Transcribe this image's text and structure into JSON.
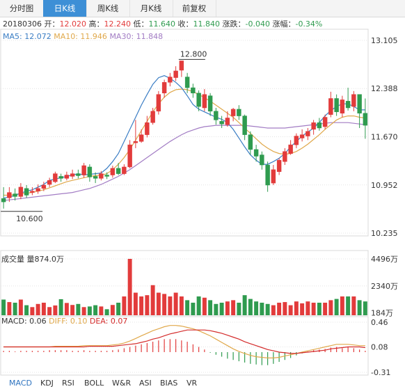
{
  "tabs": [
    {
      "label": "分时图",
      "active": false
    },
    {
      "label": "日K线",
      "active": true
    },
    {
      "label": "周K线",
      "active": false
    },
    {
      "label": "月K线",
      "active": false
    },
    {
      "label": "前复权",
      "active": false
    }
  ],
  "quote": {
    "date": "20180306",
    "open_label": "开：",
    "open": "12.020",
    "high_label": "高：",
    "high": "12.240",
    "low_label": "低：",
    "low": "11.640",
    "close_label": "收：",
    "close": "11.840",
    "change_label": "涨跌：",
    "change": "-0.040",
    "pct_label": "涨幅：",
    "pct": "-0.34%"
  },
  "ma_legend": {
    "ma5": "MA5: 12.072",
    "ma10": "MA10: 11.946",
    "ma30": "MA30: 11.848"
  },
  "volume_title": "成交量 量874.0万",
  "macd_legend": {
    "macd": "MACD: 0.06",
    "diff": "DIFF: 0.10",
    "dea": "DEA: 0.07"
  },
  "indicator_tabs": [
    "MACD",
    "KDJ",
    "RSI",
    "BOLL",
    "W&R",
    "ASI",
    "BIAS",
    "VR"
  ],
  "active_indicator": "MACD",
  "colors": {
    "up": "#e23b3b",
    "down": "#2f9b4f",
    "ma5": "#3a7dc4",
    "ma10": "#e0a84a",
    "ma30": "#a27cc4",
    "diff": "#e0a84a",
    "dea": "#d42b2b",
    "tab_active": "#3d8fd6"
  },
  "chart_data": {
    "type": "candlestick",
    "price_axis": {
      "ticks": [
        "13.105",
        "12.388",
        "11.670",
        "10.952",
        "10.235"
      ],
      "ylim": [
        10.235,
        13.105
      ]
    },
    "volume_axis": {
      "ticks": [
        "4496万",
        "2340万",
        "184万"
      ],
      "ylim": [
        0,
        4496
      ]
    },
    "macd_axis": {
      "ticks": [
        "0.46",
        "0.08",
        "-0.31"
      ],
      "ylim": [
        -0.31,
        0.46
      ]
    },
    "annotations": {
      "max": "12.800",
      "min": "10.600"
    },
    "candles": [
      [
        10.75,
        10.7,
        10.92,
        10.6
      ],
      [
        10.76,
        10.84,
        10.92,
        10.7
      ],
      [
        10.82,
        10.78,
        10.9,
        10.72
      ],
      [
        10.78,
        10.92,
        10.98,
        10.74
      ],
      [
        10.9,
        10.8,
        10.95,
        10.76
      ],
      [
        10.84,
        10.86,
        10.92,
        10.8
      ],
      [
        10.86,
        10.9,
        10.96,
        10.82
      ],
      [
        10.9,
        10.95,
        11.0,
        10.86
      ],
      [
        10.96,
        11.02,
        11.06,
        10.92
      ],
      [
        11.0,
        11.12,
        11.15,
        10.98
      ],
      [
        11.08,
        11.05,
        11.12,
        11.0
      ],
      [
        11.05,
        11.1,
        11.15,
        11.02
      ],
      [
        11.08,
        11.12,
        11.18,
        11.04
      ],
      [
        11.12,
        11.09,
        11.18,
        11.05
      ],
      [
        11.1,
        11.24,
        11.28,
        11.06
      ],
      [
        11.22,
        11.07,
        11.26,
        11.0
      ],
      [
        11.08,
        11.05,
        11.14,
        10.98
      ],
      [
        11.05,
        11.12,
        11.16,
        11.02
      ],
      [
        11.1,
        11.08,
        11.14,
        11.04
      ],
      [
        11.1,
        11.2,
        11.24,
        11.06
      ],
      [
        11.2,
        11.12,
        11.28,
        11.1
      ],
      [
        11.12,
        11.22,
        11.26,
        11.1
      ],
      [
        11.22,
        11.55,
        11.62,
        11.2
      ],
      [
        11.58,
        11.6,
        11.92,
        11.5
      ],
      [
        11.6,
        11.7,
        11.78,
        11.58
      ],
      [
        11.7,
        11.88,
        11.98,
        11.66
      ],
      [
        11.88,
        12.05,
        12.1,
        11.85
      ],
      [
        12.05,
        12.3,
        12.35,
        12.0
      ],
      [
        12.32,
        12.48,
        12.52,
        12.25
      ],
      [
        12.48,
        12.56,
        12.62,
        12.42
      ],
      [
        12.55,
        12.65,
        12.72,
        12.5
      ],
      [
        12.66,
        12.8,
        12.8,
        12.56
      ],
      [
        12.56,
        12.4,
        12.62,
        12.32
      ],
      [
        12.4,
        12.32,
        12.46,
        12.25
      ],
      [
        12.32,
        12.12,
        12.36,
        12.05
      ],
      [
        12.1,
        12.3,
        12.38,
        12.05
      ],
      [
        12.28,
        12.05,
        12.32,
        11.98
      ],
      [
        12.05,
        11.92,
        12.1,
        11.85
      ],
      [
        11.9,
        11.86,
        11.98,
        11.8
      ],
      [
        11.85,
        11.95,
        12.05,
        11.82
      ],
      [
        11.98,
        12.08,
        12.1,
        11.9
      ],
      [
        12.08,
        11.98,
        12.14,
        11.92
      ],
      [
        11.98,
        11.7,
        12.0,
        11.62
      ],
      [
        11.7,
        11.48,
        11.75,
        11.4
      ],
      [
        11.48,
        11.38,
        11.55,
        11.3
      ],
      [
        11.4,
        11.25,
        11.45,
        11.18
      ],
      [
        11.25,
        10.95,
        11.3,
        10.85
      ],
      [
        10.98,
        11.18,
        11.25,
        10.95
      ],
      [
        11.15,
        11.32,
        11.35,
        11.1
      ],
      [
        11.3,
        11.45,
        11.5,
        11.25
      ],
      [
        11.42,
        11.55,
        11.62,
        11.4
      ],
      [
        11.55,
        11.68,
        11.72,
        11.5
      ],
      [
        11.65,
        11.7,
        11.78,
        11.6
      ],
      [
        11.68,
        11.75,
        11.8,
        11.62
      ],
      [
        11.78,
        11.88,
        11.92,
        11.7
      ],
      [
        11.88,
        11.8,
        11.95,
        11.76
      ],
      [
        11.82,
        11.96,
        12.0,
        11.78
      ],
      [
        12.0,
        12.24,
        12.34,
        11.96
      ],
      [
        12.24,
        12.04,
        12.3,
        11.98
      ],
      [
        12.02,
        12.22,
        12.28,
        11.96
      ],
      [
        12.2,
        12.1,
        12.4,
        12.06
      ],
      [
        12.12,
        12.3,
        12.35,
        12.05
      ],
      [
        12.3,
        12.02,
        12.3,
        11.8
      ],
      [
        12.02,
        11.84,
        12.24,
        11.64
      ]
    ],
    "ma5": [
      10.76,
      10.77,
      10.8,
      10.83,
      10.86,
      10.88,
      10.92,
      10.96,
      11.02,
      11.04,
      11.06,
      11.08,
      11.1,
      11.12,
      11.1,
      11.11,
      11.12,
      11.13,
      11.2,
      11.3,
      11.42,
      11.6,
      11.78,
      11.96,
      12.14,
      12.3,
      12.45,
      12.55,
      12.58,
      12.54,
      12.48,
      12.4,
      12.28,
      12.15,
      12.08,
      12.04,
      12.0,
      11.96,
      11.93,
      11.88,
      11.78,
      11.65,
      11.52,
      11.4,
      11.32,
      11.26,
      11.26,
      11.3,
      11.35,
      11.42,
      11.52,
      11.6,
      11.68,
      11.74,
      11.8,
      11.88,
      11.98,
      12.06,
      12.12,
      12.16,
      12.16,
      12.12,
      12.07,
      12.07
    ],
    "ma10": [
      10.8,
      10.8,
      10.81,
      10.82,
      10.83,
      10.84,
      10.86,
      10.88,
      10.91,
      10.94,
      10.97,
      11.0,
      11.02,
      11.04,
      11.06,
      11.08,
      11.09,
      11.1,
      11.12,
      11.18,
      11.26,
      11.36,
      11.48,
      11.62,
      11.76,
      11.9,
      12.04,
      12.16,
      12.26,
      12.33,
      12.37,
      12.38,
      12.37,
      12.34,
      12.3,
      12.25,
      12.2,
      12.14,
      12.08,
      12.02,
      11.96,
      11.88,
      11.8,
      11.72,
      11.64,
      11.56,
      11.5,
      11.45,
      11.42,
      11.41,
      11.42,
      11.45,
      11.5,
      11.56,
      11.63,
      11.7,
      11.78,
      11.85,
      11.92,
      11.96,
      11.98,
      11.98,
      11.96,
      11.95
    ],
    "ma30": [
      10.72,
      10.73,
      10.74,
      10.75,
      10.76,
      10.77,
      10.78,
      10.79,
      10.8,
      10.81,
      10.82,
      10.83,
      10.84,
      10.86,
      10.88,
      10.9,
      10.93,
      10.96,
      11.0,
      11.04,
      11.08,
      11.13,
      11.18,
      11.24,
      11.3,
      11.36,
      11.42,
      11.48,
      11.54,
      11.6,
      11.65,
      11.7,
      11.74,
      11.77,
      11.8,
      11.82,
      11.83,
      11.84,
      11.84,
      11.84,
      11.84,
      11.84,
      11.84,
      11.83,
      11.82,
      11.81,
      11.8,
      11.8,
      11.8,
      11.8,
      11.81,
      11.82,
      11.83,
      11.84,
      11.85,
      11.86,
      11.87,
      11.88,
      11.88,
      11.88,
      11.88,
      11.87,
      11.86,
      11.85
    ],
    "volume": [
      1250,
      1050,
      1000,
      1250,
      800,
      650,
      900,
      1000,
      650,
      780,
      1280,
      980,
      820,
      900,
      650,
      700,
      800,
      700,
      480,
      820,
      1000,
      1500,
      4496,
      1800,
      1500,
      1600,
      2400,
      1800,
      1700,
      1500,
      1800,
      1500,
      1200,
      1000,
      1500,
      1400,
      1200,
      900,
      1000,
      1100,
      1200,
      1000,
      1600,
      1300,
      1100,
      1000,
      900,
      800,
      1000,
      1050,
      800,
      1100,
      950,
      1100,
      1000,
      1000,
      1000,
      1200,
      1300,
      1500,
      1500,
      1500,
      1200,
      1100
    ],
    "macd_hist": [
      0.02,
      0.02,
      0.01,
      0.02,
      0.02,
      0.02,
      0.02,
      0.02,
      0.03,
      0.03,
      0.03,
      0.03,
      0.02,
      0.02,
      0.03,
      0.02,
      0.02,
      0.02,
      0.02,
      0.03,
      0.04,
      0.06,
      0.08,
      0.1,
      0.12,
      0.14,
      0.16,
      0.18,
      0.2,
      0.2,
      0.2,
      0.18,
      0.16,
      0.12,
      0.08,
      0.04,
      -0.01,
      -0.04,
      -0.07,
      -0.1,
      -0.12,
      -0.14,
      -0.16,
      -0.18,
      -0.19,
      -0.2,
      -0.2,
      -0.18,
      -0.15,
      -0.12,
      -0.09,
      -0.05,
      -0.02,
      0.01,
      0.03,
      0.04,
      0.05,
      0.07,
      0.08,
      0.06,
      0.08,
      0.06,
      0.04,
      0.02
    ],
    "diff": [
      0.08,
      0.08,
      0.08,
      0.08,
      0.08,
      0.08,
      0.08,
      0.08,
      0.08,
      0.09,
      0.09,
      0.09,
      0.09,
      0.09,
      0.1,
      0.1,
      0.1,
      0.1,
      0.1,
      0.11,
      0.12,
      0.14,
      0.17,
      0.21,
      0.25,
      0.29,
      0.33,
      0.36,
      0.39,
      0.41,
      0.41,
      0.4,
      0.38,
      0.36,
      0.33,
      0.29,
      0.25,
      0.2,
      0.15,
      0.1,
      0.05,
      0.01,
      -0.02,
      -0.05,
      -0.07,
      -0.08,
      -0.09,
      -0.09,
      -0.08,
      -0.06,
      -0.04,
      -0.02,
      0.0,
      0.02,
      0.04,
      0.06,
      0.08,
      0.1,
      0.12,
      0.12,
      0.12,
      0.11,
      0.1,
      0.1
    ],
    "dea": [
      0.08,
      0.08,
      0.08,
      0.08,
      0.08,
      0.08,
      0.08,
      0.08,
      0.08,
      0.08,
      0.08,
      0.08,
      0.08,
      0.08,
      0.08,
      0.09,
      0.09,
      0.09,
      0.09,
      0.09,
      0.1,
      0.11,
      0.12,
      0.13,
      0.15,
      0.17,
      0.2,
      0.22,
      0.25,
      0.28,
      0.3,
      0.32,
      0.34,
      0.34,
      0.34,
      0.34,
      0.33,
      0.31,
      0.29,
      0.26,
      0.23,
      0.2,
      0.16,
      0.13,
      0.1,
      0.07,
      0.04,
      0.02,
      0.0,
      -0.01,
      -0.02,
      -0.02,
      -0.01,
      0.0,
      0.01,
      0.02,
      0.03,
      0.05,
      0.06,
      0.07,
      0.08,
      0.08,
      0.08,
      0.07
    ]
  }
}
